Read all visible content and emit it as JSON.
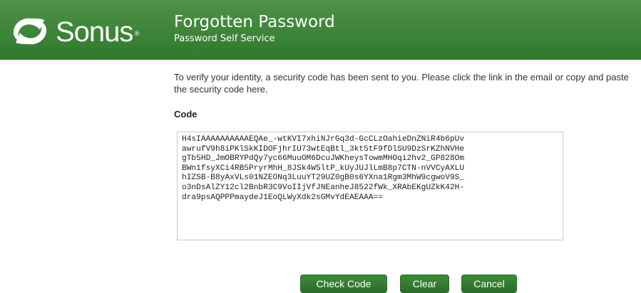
{
  "header": {
    "brand": "Sonus",
    "brand_reg": "®",
    "title": "Forgotten Password",
    "subtitle": "Password Self Service",
    "color_top": "#4f9148",
    "color_bottom": "#2f7a2b"
  },
  "main": {
    "instructions": "To verify your identity, a security code has been sent to you. Please click the link in the email or copy and paste the security code here.",
    "code_label": "Code",
    "code_value": "H4sIAAAAAAAAAAEQAe_-wtKVI7xhiNJrGq3d-GcCLzOahieDnZNiR4b6pUv\nawrufV9h8iPKlSkKIDOFjhrIU73wtEqBtl_3kt5tF9fDlSU9DzSrKZhNVHe\ngTb5HD_JmOBRYPdQy7yc66MuuOM6DcuJWKheysTowmMHOqi2hv2_GP828Om\nBWn1fsyXCi4RB5PryrMhH_8JSk4W5ltP_kUyJUJlLmB8p7CTN-nVVCyAXLU\nhIZSB-B8yAxVLs01NZEONq3LuuYT29UZ0gB0s6YXna1Rgm3MhW9cgwoV9S_\no3nDsAlZY12cl2BnbR3C9VoIIjVfJNEanheJ8522fWk_XRAbEKgUZkK42H-\ndra9psAQPPPmaydeJ1EoQLWyXdk2sGMvYdEAEAAA=="
  },
  "buttons": {
    "check_code": "Check Code",
    "clear": "Clear",
    "cancel": "Cancel",
    "color": "#2f7a2b"
  }
}
